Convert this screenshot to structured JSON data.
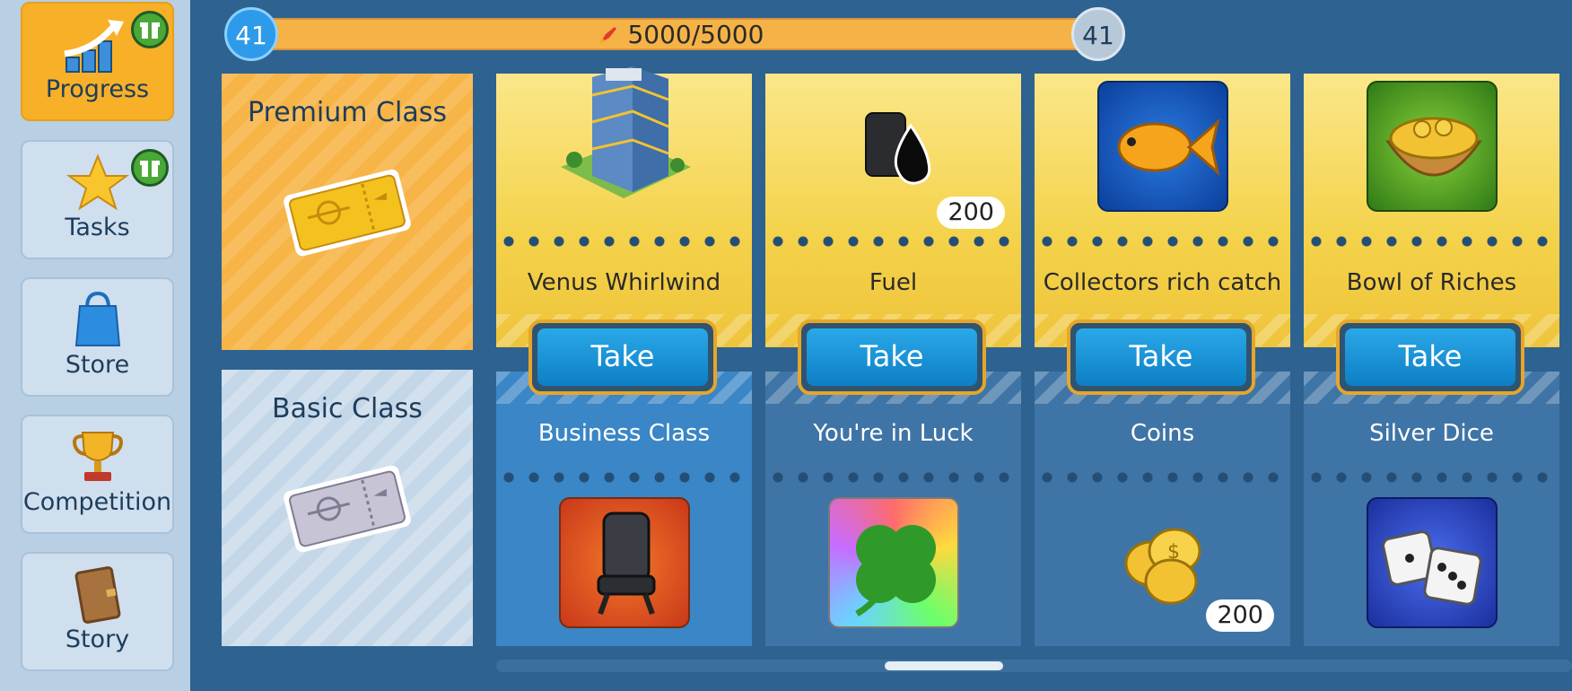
{
  "sidebar": {
    "items": [
      {
        "label": "Progress",
        "icon": "progress-chart-icon",
        "active": true,
        "gift": true
      },
      {
        "label": "Tasks",
        "icon": "star-icon",
        "gift": true
      },
      {
        "label": "Store",
        "icon": "shopping-bag-icon"
      },
      {
        "label": "Competition",
        "icon": "trophy-icon"
      },
      {
        "label": "Story",
        "icon": "book-icon"
      }
    ]
  },
  "progress": {
    "level_current": "41",
    "level_next": "41",
    "value_text": "5000/5000",
    "fraction": 1.0
  },
  "classes": {
    "premium": {
      "title": "Premium Class",
      "icon": "gold-ticket-icon"
    },
    "basic": {
      "title": "Basic Class",
      "icon": "silver-ticket-icon"
    }
  },
  "rewards": [
    {
      "premium": {
        "name": "Venus Whirlwind",
        "icon": "skyscraper-building-icon",
        "qty": ""
      },
      "button": "Take",
      "basic": {
        "name": "Business Class",
        "icon": "airplane-seat-icon",
        "qty": ""
      }
    },
    {
      "premium": {
        "name": "Fuel",
        "icon": "fuel-barrel-icon",
        "qty": "200"
      },
      "button": "Take",
      "basic": {
        "name": "You're in Luck",
        "icon": "four-leaf-clover-icon",
        "qty": ""
      }
    },
    {
      "premium": {
        "name": "Collectors rich catch",
        "icon": "goldfish-icon",
        "qty": ""
      },
      "button": "Take",
      "basic": {
        "name": "Coins",
        "icon": "coins-icon",
        "qty": "200"
      }
    },
    {
      "premium": {
        "name": "Bowl of Riches",
        "icon": "coin-bowl-icon",
        "qty": ""
      },
      "button": "Take",
      "basic": {
        "name": "Silver Dice",
        "icon": "dice-icon",
        "qty": ""
      }
    }
  ],
  "colors": {
    "accent_orange": "#f7b028",
    "button_blue": "#1a93d8",
    "background": "#2e6290"
  }
}
